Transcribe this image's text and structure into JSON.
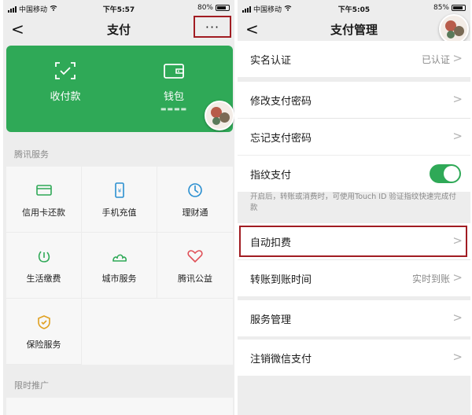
{
  "left": {
    "status": {
      "carrier": "中国移动",
      "time": "下午5:57",
      "battery": "80%",
      "battery_level": 0.8
    },
    "nav": {
      "back": "<",
      "title": "支付",
      "more": "···"
    },
    "card": {
      "receive": "收付款",
      "wallet": "钱包"
    },
    "section_tencent": "腾讯服务",
    "services": [
      "信用卡还款",
      "手机充值",
      "理财通",
      "生活缴费",
      "城市服务",
      "腾讯公益",
      "保险服务"
    ],
    "section_promo": "限时推广"
  },
  "right": {
    "status": {
      "carrier": "中国移动",
      "time": "下午5:05",
      "battery": "85%",
      "battery_level": 0.85
    },
    "nav": {
      "back": "<",
      "title": "支付管理"
    },
    "rows": {
      "realname": {
        "label": "实名认证",
        "value": "已认证"
      },
      "change_pwd": {
        "label": "修改支付密码"
      },
      "forgot_pwd": {
        "label": "忘记支付密码"
      },
      "fingerprint": {
        "label": "指纹支付",
        "enabled": true,
        "note": "开启后，转账或消费时，可使用Touch ID 验证指纹快速完成付款"
      },
      "auto_deduct": {
        "label": "自动扣费"
      },
      "transfer_time": {
        "label": "转账到账时间",
        "value": "实时到账"
      },
      "service_mgmt": {
        "label": "服务管理"
      },
      "cancel_pay": {
        "label": "注销微信支付"
      }
    },
    "chevron": ">"
  },
  "colors": {
    "green": "#2fa957",
    "highlight": "#a11c22",
    "bg": "#ededed"
  }
}
